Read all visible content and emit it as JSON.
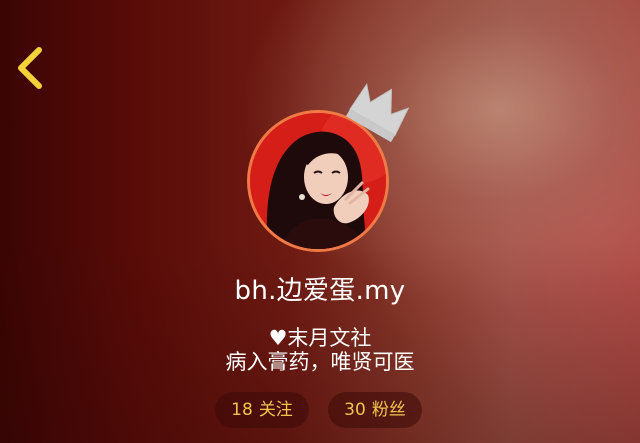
{
  "header": {
    "back_icon": "chevron-left-icon",
    "back_color": "#f4d23a"
  },
  "profile": {
    "username": "bh.边爱蛋.my",
    "avatar_ring_color": "#f07a45",
    "crown_icon": "crown-icon",
    "bio_line_1": "♥末月文社",
    "bio_line_2": "病入膏药，唯贤可医"
  },
  "stats": {
    "following_count": "18",
    "following_label": "关注",
    "fans_count": "30",
    "fans_label": "粉丝",
    "accent_color": "#f2c44e"
  }
}
